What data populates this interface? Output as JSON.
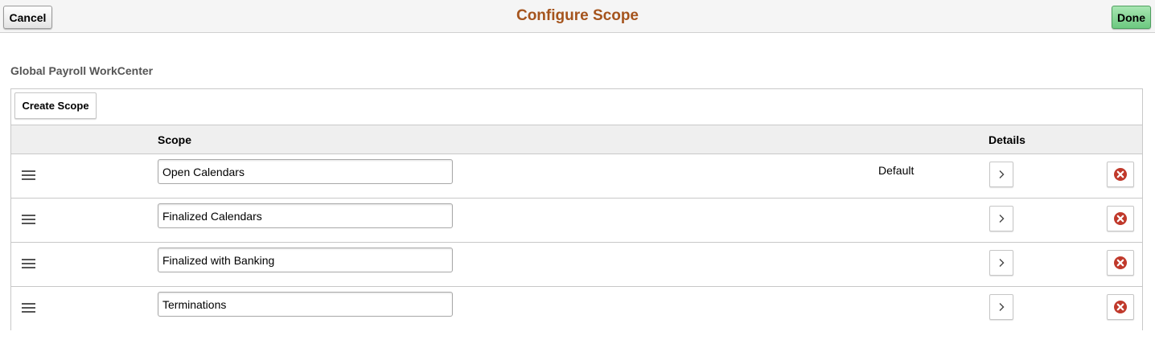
{
  "header": {
    "title": "Configure Scope",
    "cancel_label": "Cancel",
    "done_label": "Done",
    "title_color": "#a5541d",
    "done_color": "#6cc880"
  },
  "section": {
    "title": "Global Payroll WorkCenter"
  },
  "grid": {
    "create_label": "Create Scope",
    "columns": {
      "scope": "Scope",
      "details": "Details"
    },
    "rows": [
      {
        "scope": "Open Calendars",
        "default_label": "Default"
      },
      {
        "scope": "Finalized Calendars",
        "default_label": ""
      },
      {
        "scope": "Finalized with Banking",
        "default_label": ""
      },
      {
        "scope": "Terminations",
        "default_label": ""
      }
    ],
    "icons": {
      "drag": "drag-handle-icon",
      "details": "chevron-right-icon",
      "delete": "delete-circle-icon"
    },
    "delete_color": "#c0392b"
  }
}
